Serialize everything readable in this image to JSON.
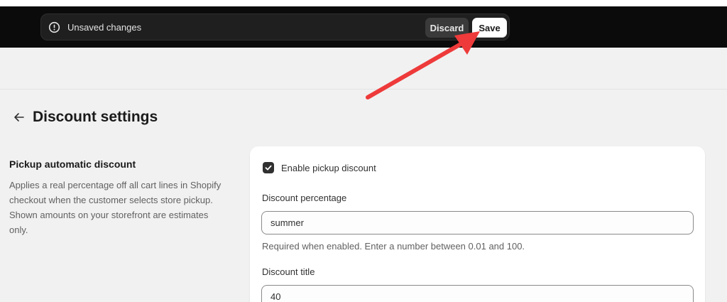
{
  "savebar": {
    "message": "Unsaved changes",
    "discard_label": "Discard",
    "save_label": "Save"
  },
  "page": {
    "title": "Discount settings"
  },
  "section": {
    "title": "Pickup automatic discount",
    "description": "Applies a real percentage off all cart lines in Shopify checkout when the customer selects store pickup. Shown amounts on your storefront are estimates only."
  },
  "form": {
    "enable_label": "Enable pickup discount",
    "enable_checked": true,
    "percentage_label": "Discount percentage",
    "percentage_value": "summer",
    "percentage_help": "Required when enabled. Enter a number between 0.01 and 100.",
    "title_label": "Discount title",
    "title_value": "40"
  },
  "annotation": {
    "arrow_color": "#ee3a3a"
  }
}
